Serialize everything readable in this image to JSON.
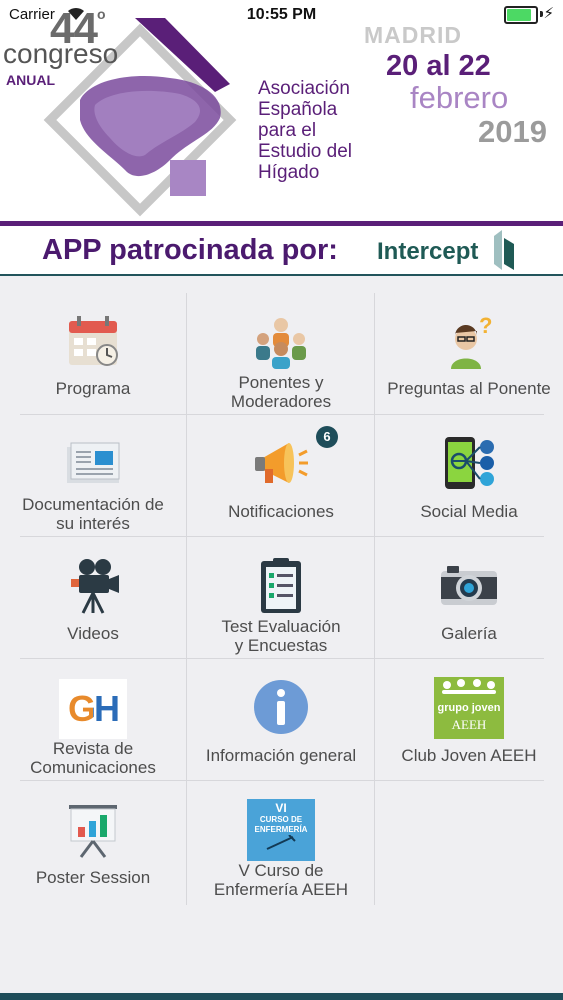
{
  "status_bar": {
    "carrier": "Carrier",
    "time": "10:55 PM"
  },
  "banner": {
    "congress_number": "44",
    "congress_degree": "o",
    "congress_word": "congreso",
    "congress_anual": "ANUAL",
    "association_lines": [
      "Asociación",
      "Española",
      "para el",
      "Estudio del",
      "Hígado"
    ],
    "city": "MADRID",
    "dates": "20 al 22",
    "month": "febrero",
    "year": "2019"
  },
  "sponsor": {
    "label": "APP patrocinada por:",
    "logo_text": "Intercept"
  },
  "menu": [
    {
      "label": "Programa",
      "icon": "calendar-icon"
    },
    {
      "label": "Ponentes y\nModeradores",
      "icon": "speakers-group-icon"
    },
    {
      "label": "Preguntas al Ponente",
      "icon": "question-person-icon"
    },
    {
      "label": "Documentación de\nsu interés",
      "icon": "newspaper-icon"
    },
    {
      "label": "Notificaciones",
      "icon": "megaphone-icon",
      "badge": "6"
    },
    {
      "label": "Social Media",
      "icon": "social-phone-icon"
    },
    {
      "label": "Videos",
      "icon": "video-camera-icon"
    },
    {
      "label": "Test Evaluación\ny Encuestas",
      "icon": "clipboard-checklist-icon"
    },
    {
      "label": "Galería",
      "icon": "photo-camera-icon"
    },
    {
      "label": "Revista de\nComunicaciones",
      "icon": "gh-journal-icon",
      "icon_text": "GH"
    },
    {
      "label": "Información general",
      "icon": "info-icon"
    },
    {
      "label": "Club Joven AEEH",
      "icon": "grupo-joven-icon",
      "icon_text": "grupo joven",
      "icon_subtext": "AEEH"
    },
    {
      "label": "Poster Session",
      "icon": "presentation-board-icon"
    },
    {
      "label": "V Curso de\nEnfermería  AEEH",
      "icon": "nursing-course-icon",
      "icon_text": "VI",
      "icon_subtext": "CURSO DE ENFERMERÍA"
    }
  ],
  "colors": {
    "brand_purple": "#5a1f78",
    "accent_teal": "#1e4d5a",
    "background": "#efeff2"
  }
}
